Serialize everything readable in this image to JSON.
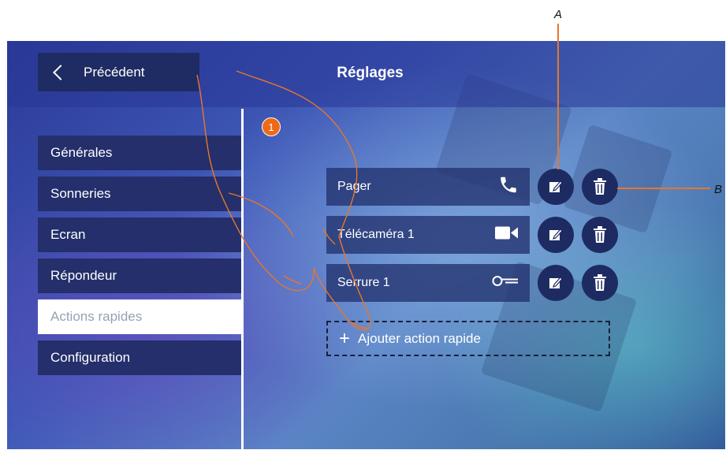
{
  "header": {
    "back_label": "Précédent",
    "title": "Réglages"
  },
  "menu": {
    "items": [
      {
        "label": "Générales",
        "active": false
      },
      {
        "label": "Sonneries",
        "active": false
      },
      {
        "label": "Ecran",
        "active": false
      },
      {
        "label": "Répondeur",
        "active": false
      },
      {
        "label": "Actions rapides",
        "active": true
      },
      {
        "label": "Configuration",
        "active": false
      }
    ]
  },
  "step_badge": "1",
  "quick_actions": [
    {
      "label": "Pager",
      "icon": "phone-icon"
    },
    {
      "label": "Télécaméra 1",
      "icon": "video-camera-icon"
    },
    {
      "label": "Serrure 1",
      "icon": "key-icon"
    }
  ],
  "add_action_label": "Ajouter action rapide",
  "callouts": {
    "a": "A",
    "b": "B"
  },
  "colors": {
    "accent": "#e8762b",
    "panel": "#242f6b",
    "button": "#1e2b63"
  }
}
